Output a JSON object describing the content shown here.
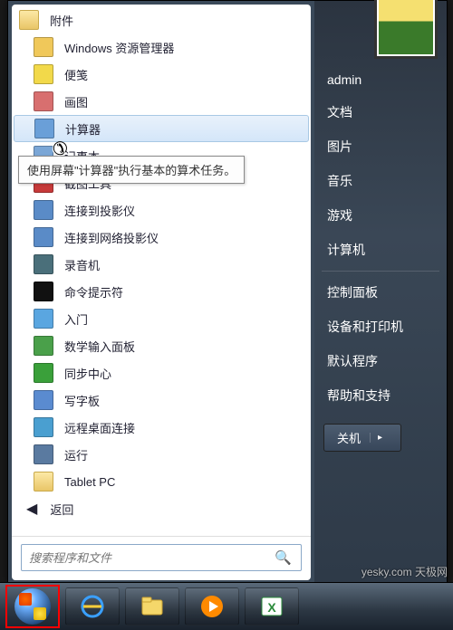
{
  "startmenu": {
    "folder_title": "附件",
    "items": [
      {
        "label": "Windows 资源管理器",
        "icon_color": "#f0c85a"
      },
      {
        "label": "便笺",
        "icon_color": "#f2d94a"
      },
      {
        "label": "画图",
        "icon_color": "#d86f6f"
      },
      {
        "label": "计算器",
        "icon_color": "#6a9fd8",
        "highlight": true,
        "red": true
      },
      {
        "label": "记事本",
        "icon_color": "#7aa6d6",
        "partial": true
      },
      {
        "label": "截图工具",
        "icon_color": "#c73a3a",
        "partial": true
      },
      {
        "label": "连接到投影仪",
        "icon_color": "#5a8bc7"
      },
      {
        "label": "连接到网络投影仪",
        "icon_color": "#5a8bc7"
      },
      {
        "label": "录音机",
        "icon_color": "#4a6f7a"
      },
      {
        "label": "命令提示符",
        "icon_color": "#111"
      },
      {
        "label": "入门",
        "icon_color": "#5aa6e0"
      },
      {
        "label": "数学输入面板",
        "icon_color": "#4aa04a"
      },
      {
        "label": "同步中心",
        "icon_color": "#3aa03a"
      },
      {
        "label": "写字板",
        "icon_color": "#5a8bd0"
      },
      {
        "label": "远程桌面连接",
        "icon_color": "#4a9fd0"
      },
      {
        "label": "运行",
        "icon_color": "#5a7aa0"
      }
    ],
    "subfolders": [
      {
        "label": "Tablet PC"
      }
    ],
    "back_label": "返回",
    "tooltip": "使用屏幕\"计算器\"执行基本的算术任务。"
  },
  "search": {
    "placeholder": "搜索程序和文件"
  },
  "right_panel": {
    "user": "admin",
    "items": [
      "文档",
      "图片",
      "音乐",
      "游戏",
      "计算机"
    ],
    "items2": [
      "控制面板",
      "设备和打印机",
      "默认程序",
      "帮助和支持"
    ],
    "shutdown": "关机"
  },
  "taskbar_icons": [
    "ie",
    "explorer",
    "wmp",
    "excel"
  ],
  "watermark": "yesky.com 天极网",
  "colors": {
    "highlight": "#ff0000"
  }
}
